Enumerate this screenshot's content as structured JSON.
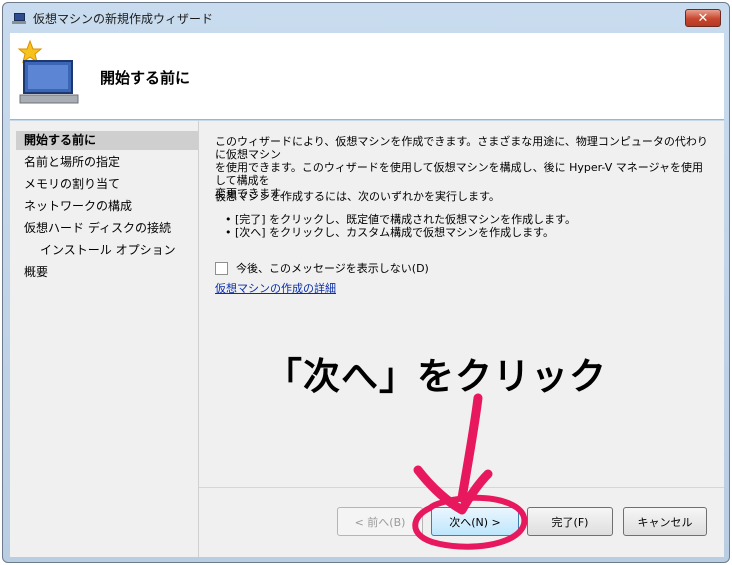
{
  "window": {
    "title": "仮想マシンの新規作成ウィザード",
    "close_label": "✕"
  },
  "header": {
    "title": "開始する前に"
  },
  "nav": {
    "items": [
      {
        "label": "開始する前に",
        "active": true
      },
      {
        "label": "名前と場所の指定"
      },
      {
        "label": "メモリの割り当て"
      },
      {
        "label": "ネットワークの構成"
      },
      {
        "label": "仮想ハード ディスクの接続"
      },
      {
        "label": "インストール オプション",
        "indent": true
      },
      {
        "label": "概要"
      }
    ]
  },
  "main": {
    "description_lines": [
      "このウィザードにより、仮想マシンを作成できます。さまざまな用途に、物理コンピュータの代わりに仮想マシン",
      "を使用できます。このウィザードを使用して仮想マシンを構成し、後に Hyper-V マネージャを使用して構成を",
      "変更できます。"
    ],
    "instruction": "仮想マシンを作成するには、次のいずれかを実行します。",
    "bullets": [
      "• [完了] をクリックし、既定値で構成された仮想マシンを作成します。",
      "• [次へ] をクリックし、カスタム構成で仮想マシンを作成します。"
    ],
    "checkbox_label": "今後、このメッセージを表示しない(D)",
    "link_text": "仮想マシンの作成の詳細"
  },
  "buttons": {
    "back": "< 前へ(B)",
    "next": "次へ(N) >",
    "finish": "完了(F)",
    "cancel": "キャンセル"
  },
  "annotation": {
    "text": "「次へ」をクリック",
    "color": "#e8185e"
  }
}
